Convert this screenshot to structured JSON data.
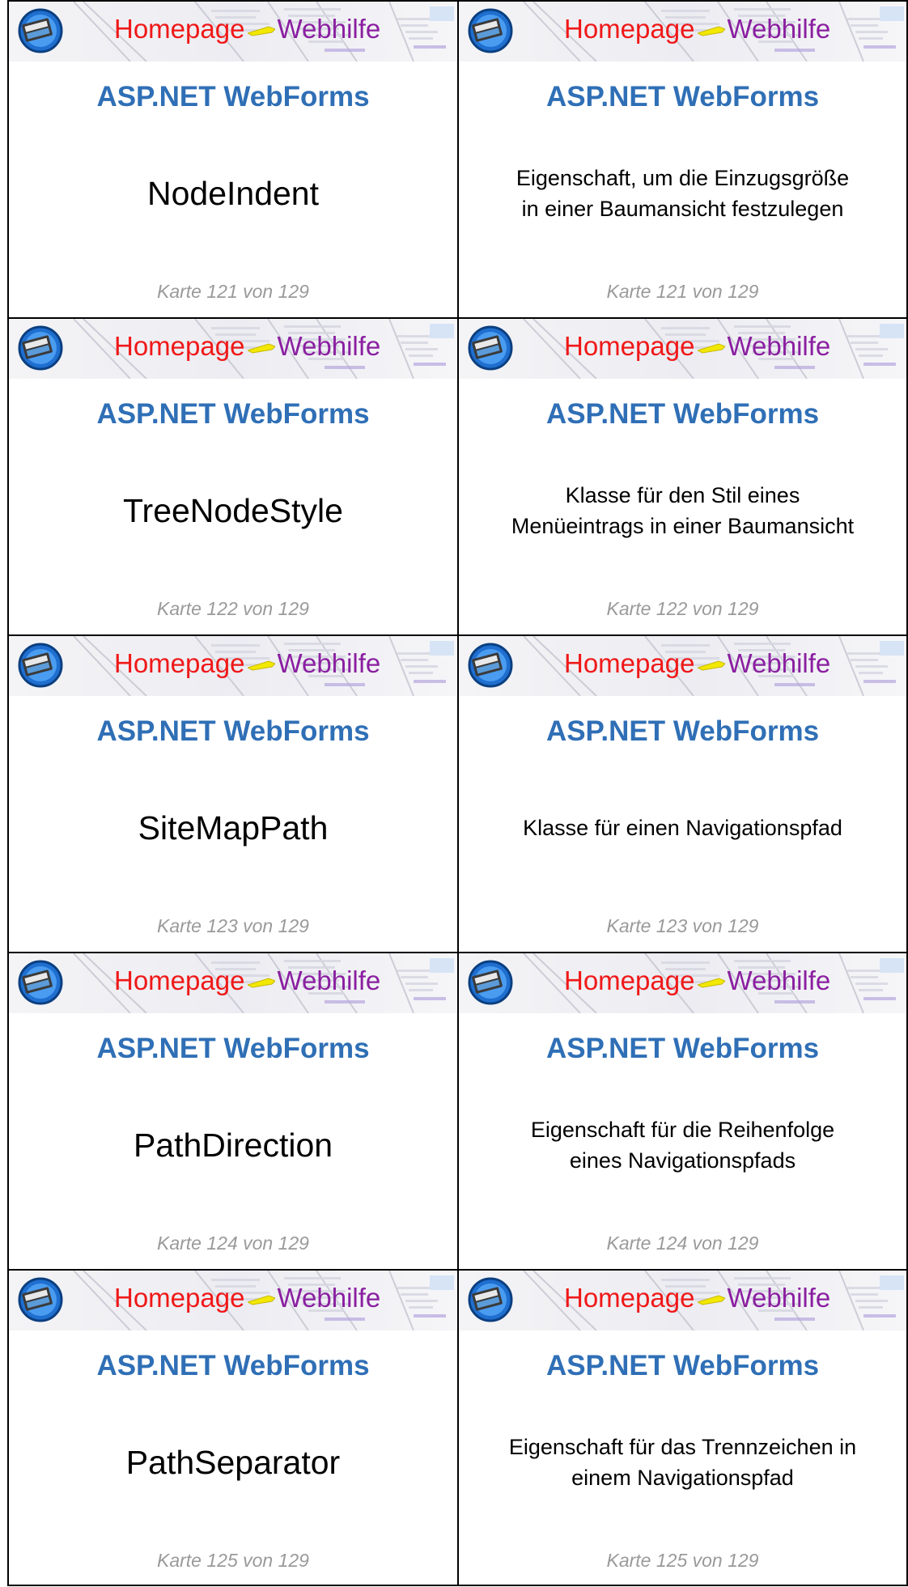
{
  "banner": {
    "part1": "Homepage",
    "part2": "Webhilfe"
  },
  "cards": [
    {
      "heading": "ASP.NET WebForms",
      "front": "NodeIndent",
      "back_line1": "Eigenschaft, um die Einzugsgröße",
      "back_line2": "in einer Baumansicht festzulegen",
      "counter": "Karte 121 von 129"
    },
    {
      "heading": "ASP.NET WebForms",
      "front": "TreeNodeStyle",
      "back_line1": "Klasse für den Stil eines",
      "back_line2": "Menüeintrags in einer Baumansicht",
      "counter": "Karte 122 von 129"
    },
    {
      "heading": "ASP.NET WebForms",
      "front": "SiteMapPath",
      "back_line1": "Klasse für einen Navigationspfad",
      "back_line2": "",
      "counter": "Karte 123 von 129"
    },
    {
      "heading": "ASP.NET WebForms",
      "front": "PathDirection",
      "back_line1": "Eigenschaft für die Reihenfolge",
      "back_line2": "eines Navigationspfads",
      "counter": "Karte 124 von 129"
    },
    {
      "heading": "ASP.NET WebForms",
      "front": "PathSeparator",
      "back_line1": "Eigenschaft für das Trennzeichen in",
      "back_line2": "einem Navigationspfad",
      "counter": "Karte 125 von 129"
    }
  ],
  "colors": {
    "heading": "#2f6fb6",
    "banner_part1": "#f01818",
    "banner_part2": "#8a1fa0",
    "counter": "#9a9a9a"
  }
}
